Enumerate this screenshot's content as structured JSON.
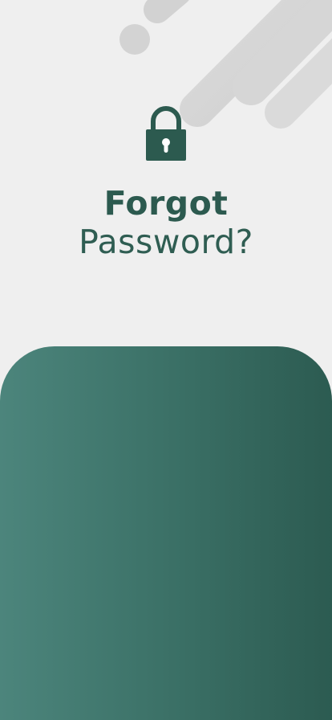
{
  "colors": {
    "background": "#efefef",
    "accent_dark": "#2c5a4f",
    "panel_gradient_start": "#4c857c",
    "panel_gradient_end": "#2c5b51",
    "decor_grey": "#d4d4d4"
  },
  "header": {
    "icon": "lock-icon",
    "title_line1": "Forgot",
    "title_line2": "Password?"
  }
}
